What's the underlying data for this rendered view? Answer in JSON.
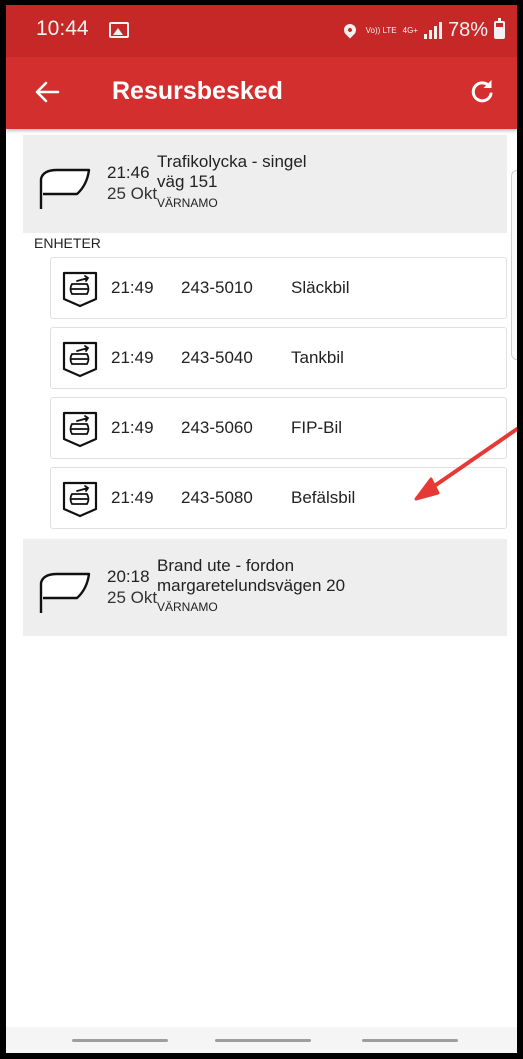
{
  "status_bar": {
    "time": "10:44",
    "volte": "Vo)) LTE",
    "network": "4G+",
    "battery": "78%",
    "icons": [
      "gallery-icon",
      "location-icon",
      "volte-icon",
      "signal-icon",
      "battery-icon"
    ]
  },
  "app_bar": {
    "title": "Resursbesked",
    "back_icon": "arrow-left-icon",
    "refresh_icon": "refresh-icon",
    "color": "#d32f2f"
  },
  "incidents": [
    {
      "time": "21:46",
      "date": "25 Okt",
      "type": "Trafikolycka - singel",
      "address": "väg 151",
      "city": "VÄRNAMO"
    },
    {
      "time": "20:18",
      "date": "25 Okt",
      "type": "Brand ute - fordon",
      "address": "margaretelundsvägen 20",
      "city": "VÄRNAMO"
    }
  ],
  "units_label": "ENHETER",
  "units": [
    {
      "time": "21:49",
      "id": "243-5010",
      "type": "Släckbil"
    },
    {
      "time": "21:49",
      "id": "243-5040",
      "type": "Tankbil"
    },
    {
      "time": "21:49",
      "id": "243-5060",
      "type": "FIP-Bil"
    },
    {
      "time": "21:49",
      "id": "243-5080",
      "type": "Befälsbil"
    }
  ],
  "annotation": {
    "color": "#e53935",
    "points_to": "243-5080 Befälsbil"
  }
}
